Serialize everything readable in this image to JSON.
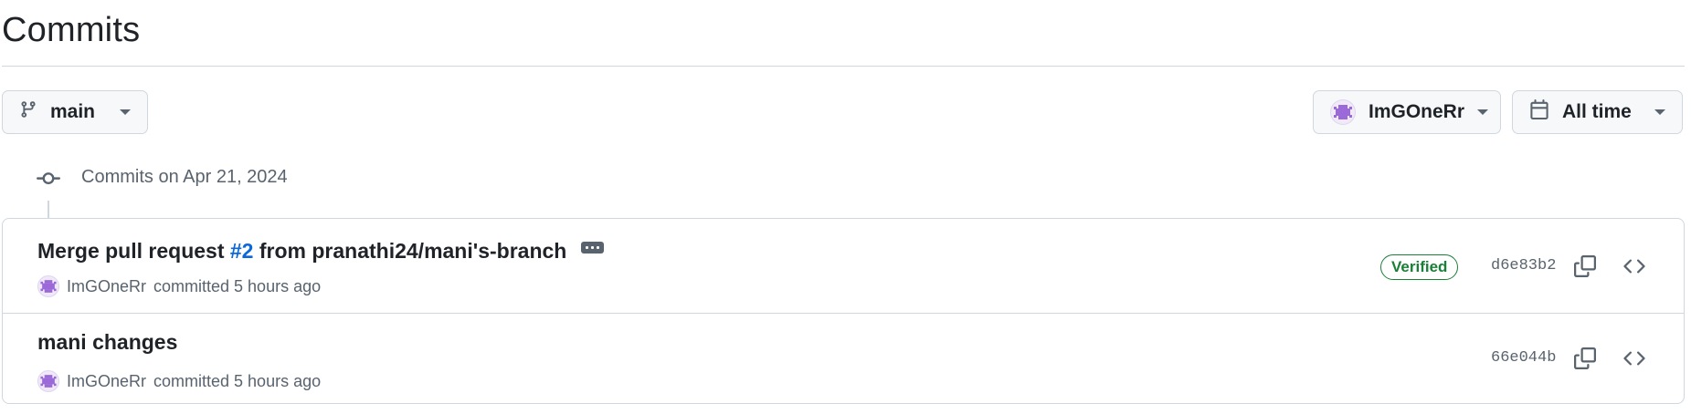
{
  "header": {
    "title": "Commits"
  },
  "toolbar": {
    "branch_label": "main",
    "branch_icon": "git-branch-icon",
    "author_label": "ImGOneRr",
    "time_label": "All time",
    "time_icon": "calendar-icon"
  },
  "timeline": {
    "date_label": "Commits on Apr 21, 2024",
    "icon": "git-commit-icon"
  },
  "commits": [
    {
      "title_prefix": "Merge pull request ",
      "pr_ref": "#2",
      "title_suffix": " from pranathi24/mani's-branch",
      "author": "ImGOneRr",
      "action": "committed 5 hours ago",
      "verified": "Verified",
      "sha": "d6e83b2"
    },
    {
      "title": "mani changes",
      "author": "ImGOneRr",
      "action": "committed 5 hours ago",
      "sha": "66e044b"
    }
  ],
  "colors": {
    "accent_link": "#0969da",
    "verified_green": "#1a7f37",
    "border": "#d0d7de",
    "muted_text": "#59636e",
    "avatar_purple": "#9b6ad8"
  }
}
